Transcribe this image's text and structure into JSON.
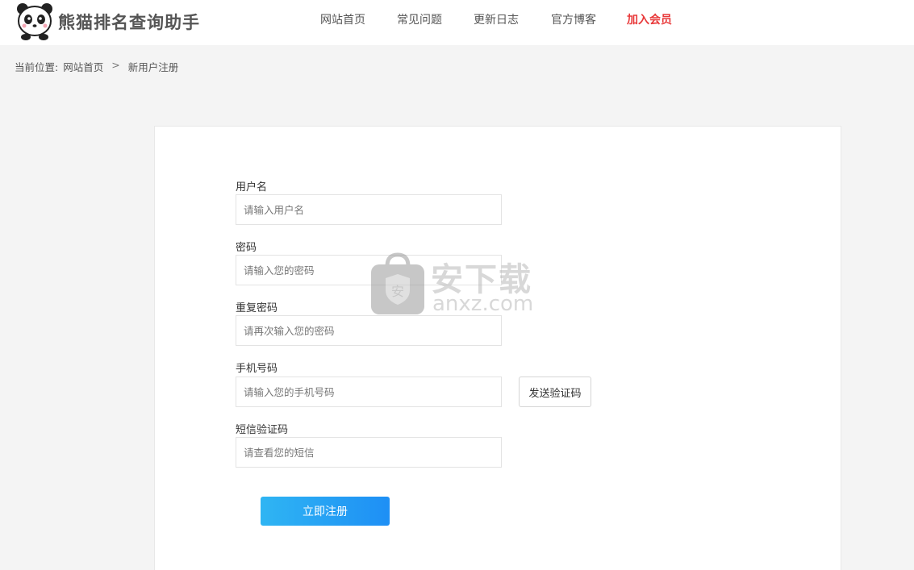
{
  "site": {
    "logo_text": "熊猫排名查询助手"
  },
  "nav": {
    "items": [
      {
        "label": "网站首页"
      },
      {
        "label": "常见问题"
      },
      {
        "label": "更新日志"
      },
      {
        "label": "官方博客"
      },
      {
        "label": "加入会员"
      }
    ]
  },
  "breadcrumb": {
    "prefix": "当前位置:",
    "home": "网站首页",
    "separator": ">",
    "current": "新用户注册"
  },
  "form": {
    "username": {
      "label": "用户名",
      "placeholder": "请输入用户名",
      "value": ""
    },
    "password": {
      "label": "密码",
      "placeholder": "请输入您的密码",
      "value": ""
    },
    "confirm_password": {
      "label": "重复密码",
      "placeholder": "请再次输入您的密码",
      "value": ""
    },
    "phone": {
      "label": "手机号码",
      "placeholder": "请输入您的手机号码",
      "value": ""
    },
    "sms_code": {
      "label": "短信验证码",
      "placeholder": "请查看您的短信",
      "value": ""
    },
    "send_code_label": "发送验证码",
    "submit_label": "立即注册"
  },
  "watermark": {
    "text": "安下载",
    "sub": "anxz.com"
  },
  "colors": {
    "accent_vip": "#e8393a",
    "button_gradient_start": "#2fb5f3",
    "button_gradient_end": "#1e8ff5",
    "background": "#f4f4f4"
  }
}
